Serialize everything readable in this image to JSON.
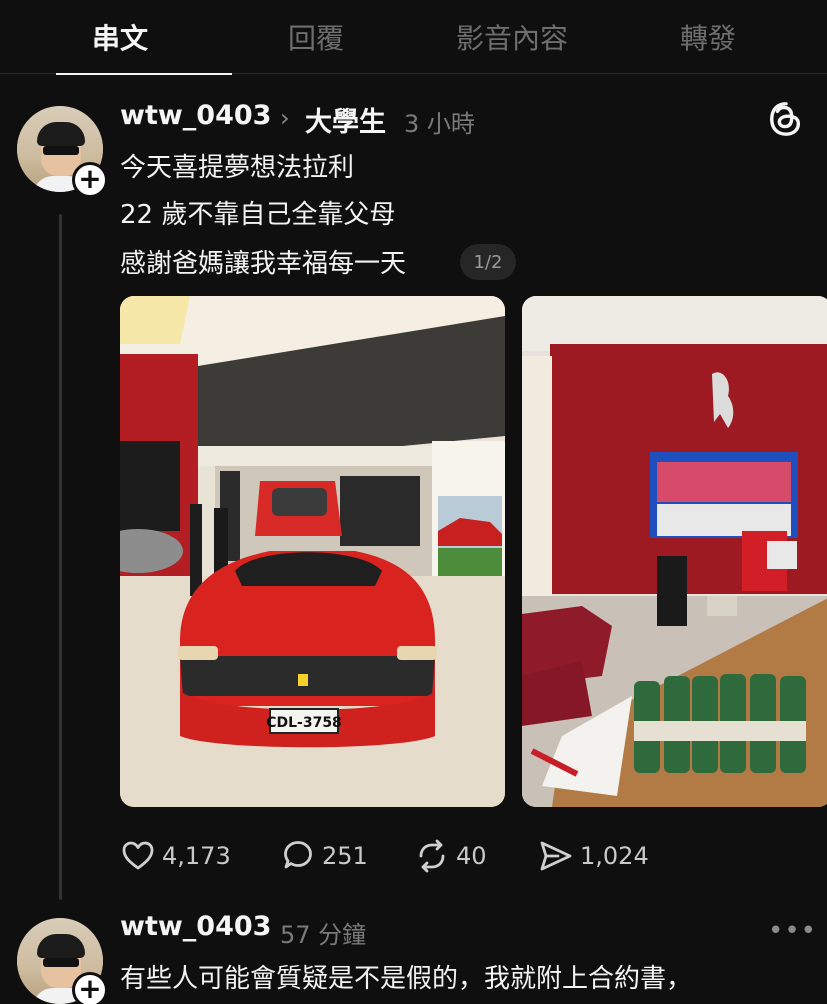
{
  "tabs": [
    {
      "label": "串文",
      "active": true
    },
    {
      "label": "回覆",
      "active": false
    },
    {
      "label": "影音內容",
      "active": false
    },
    {
      "label": "轉發",
      "active": false
    }
  ],
  "post1": {
    "username": "wtw_0403",
    "topic": "大學生",
    "time": "3 小時",
    "lines": [
      "今天喜提夢想法拉利",
      "22 歲不靠自己全靠父母",
      "感謝爸媽讓我幸福每一天"
    ],
    "page_indicator": "1/2",
    "plate": "CDL-3758",
    "actions": {
      "likes": "4,173",
      "comments": "251",
      "reposts": "40",
      "shares": "1,024"
    }
  },
  "post2": {
    "username": "wtw_0403",
    "time": "57 分鐘",
    "line": "有些人可能會質疑是不是假的，我就附上合約書，"
  },
  "icons": {
    "follow": "plus-icon",
    "threads": "threads-logo-icon",
    "like": "heart-icon",
    "comment": "comment-icon",
    "repost": "repost-icon",
    "share": "share-icon",
    "more": "more-dots-icon"
  },
  "colors": {
    "background": "#0f0f0f",
    "text": "#f3f3f3",
    "muted": "#7a7a7a",
    "ferrari_red": "#d8231f"
  }
}
